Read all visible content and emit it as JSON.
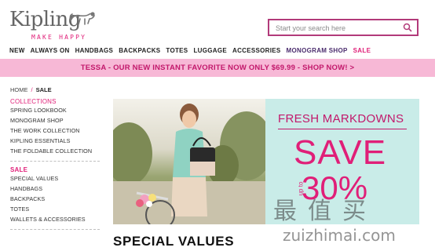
{
  "brand": {
    "name": "Kipling",
    "tagline": "MAKE HAPPY"
  },
  "search": {
    "placeholder": "Start your search here"
  },
  "nav": [
    "NEW",
    "ALWAYS ON",
    "HANDBAGS",
    "BACKPACKS",
    "TOTES",
    "LUGGAGE",
    "ACCESSORIES",
    "MONOGRAM SHOP",
    "SALE"
  ],
  "promo": {
    "text": "TESSA - OUR NEW INSTANT FAVORITE NOW ONLY $69.99 - SHOP NOW! >"
  },
  "breadcrumb": {
    "home": "HOME",
    "separator": "/",
    "current": "SALE"
  },
  "sidebar": {
    "collections_heading": "COLLECTIONS",
    "collections": [
      "SPRING LOOKBOOK",
      "MONOGRAM SHOP",
      "THE WORK COLLECTION",
      "KIPLING ESSENTIALS",
      "THE FOLDABLE COLLECTION"
    ],
    "sale_heading": "SALE",
    "sale_items": [
      "SPECIAL VALUES",
      "HANDBAGS",
      "BACKPACKS",
      "TOTES",
      "WALLETS & ACCESSORIES"
    ]
  },
  "hero": {
    "headline": "FRESH MARKDOWNS",
    "save": "SAVE",
    "up_to": "up to",
    "percent": "30%"
  },
  "section_title": "SPECIAL VALUES",
  "watermark": {
    "chars": "最值买",
    "url": "zuizhimai.com"
  },
  "colors": {
    "accent": "#e01f78",
    "promo_bg": "#f7b8d6",
    "hero_bg": "#c9ece8",
    "search_border": "#b23a7a"
  }
}
